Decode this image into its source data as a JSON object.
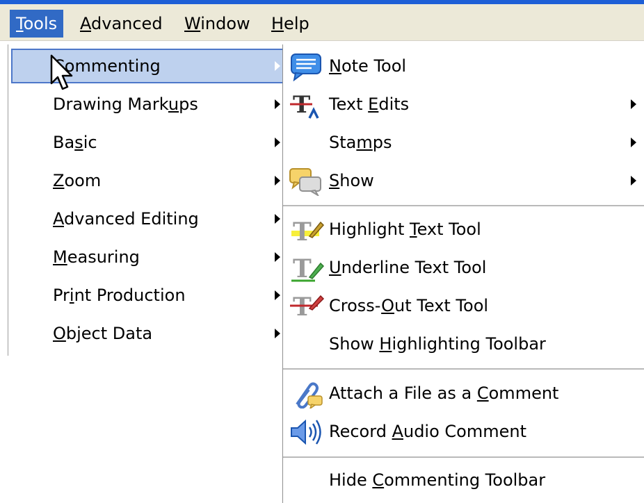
{
  "menubar": {
    "items": [
      {
        "u": "T",
        "rest": "ools"
      },
      {
        "u": "A",
        "rest": "dvanced"
      },
      {
        "u": "W",
        "rest": "indow"
      },
      {
        "u": "H",
        "rest": "elp"
      }
    ]
  },
  "tools_menu": {
    "items": [
      {
        "pre": "",
        "u": "C",
        "post": "ommenting"
      },
      {
        "pre": "Drawing Mark",
        "u": "u",
        "post": "ps"
      },
      {
        "pre": "Ba",
        "u": "s",
        "post": "ic"
      },
      {
        "pre": "",
        "u": "Z",
        "post": "oom"
      },
      {
        "pre": "",
        "u": "A",
        "post": "dvanced Editing"
      },
      {
        "pre": "",
        "u": "M",
        "post": "easuring"
      },
      {
        "pre": "Pr",
        "u": "i",
        "post": "nt Production"
      },
      {
        "pre": "",
        "u": "O",
        "post": "bject Data"
      }
    ]
  },
  "commenting_menu": {
    "items": [
      {
        "pre": "",
        "u": "N",
        "post": "ote Tool",
        "icon": "note-icon",
        "submenu": false
      },
      {
        "pre": "Text ",
        "u": "E",
        "post": "dits",
        "icon": "text-edits-icon",
        "submenu": true
      },
      {
        "pre": "Sta",
        "u": "m",
        "post": "ps",
        "icon": "",
        "submenu": true
      },
      {
        "pre": "",
        "u": "S",
        "post": "how",
        "icon": "show-comments-icon",
        "submenu": true
      },
      {
        "pre": "Highlight ",
        "u": "T",
        "post": "ext Tool",
        "icon": "highlight-text-icon",
        "submenu": false
      },
      {
        "pre": "",
        "u": "U",
        "post": "nderline Text Tool",
        "icon": "underline-text-icon",
        "submenu": false
      },
      {
        "pre": "Cross-",
        "u": "O",
        "post": "ut Text Tool",
        "icon": "cross-out-text-icon",
        "submenu": false
      },
      {
        "pre": "Show ",
        "u": "H",
        "post": "ighlighting Toolbar",
        "icon": "",
        "submenu": false
      },
      {
        "pre": "Attach a File as a ",
        "u": "C",
        "post": "omment",
        "icon": "attach-file-icon",
        "submenu": false
      },
      {
        "pre": "Record ",
        "u": "A",
        "post": "udio Comment",
        "icon": "speaker-icon",
        "submenu": false
      },
      {
        "pre": "Hide ",
        "u": "C",
        "post": "ommenting Toolbar",
        "icon": "",
        "submenu": false
      }
    ]
  },
  "colors": {
    "menubar_bg": "#ece9d8",
    "active_menu_bg": "#316ac5",
    "selected_item_bg": "#bed1ee",
    "selected_item_border": "#4d77c9",
    "title_bar_blue": "#1d5fd6"
  }
}
